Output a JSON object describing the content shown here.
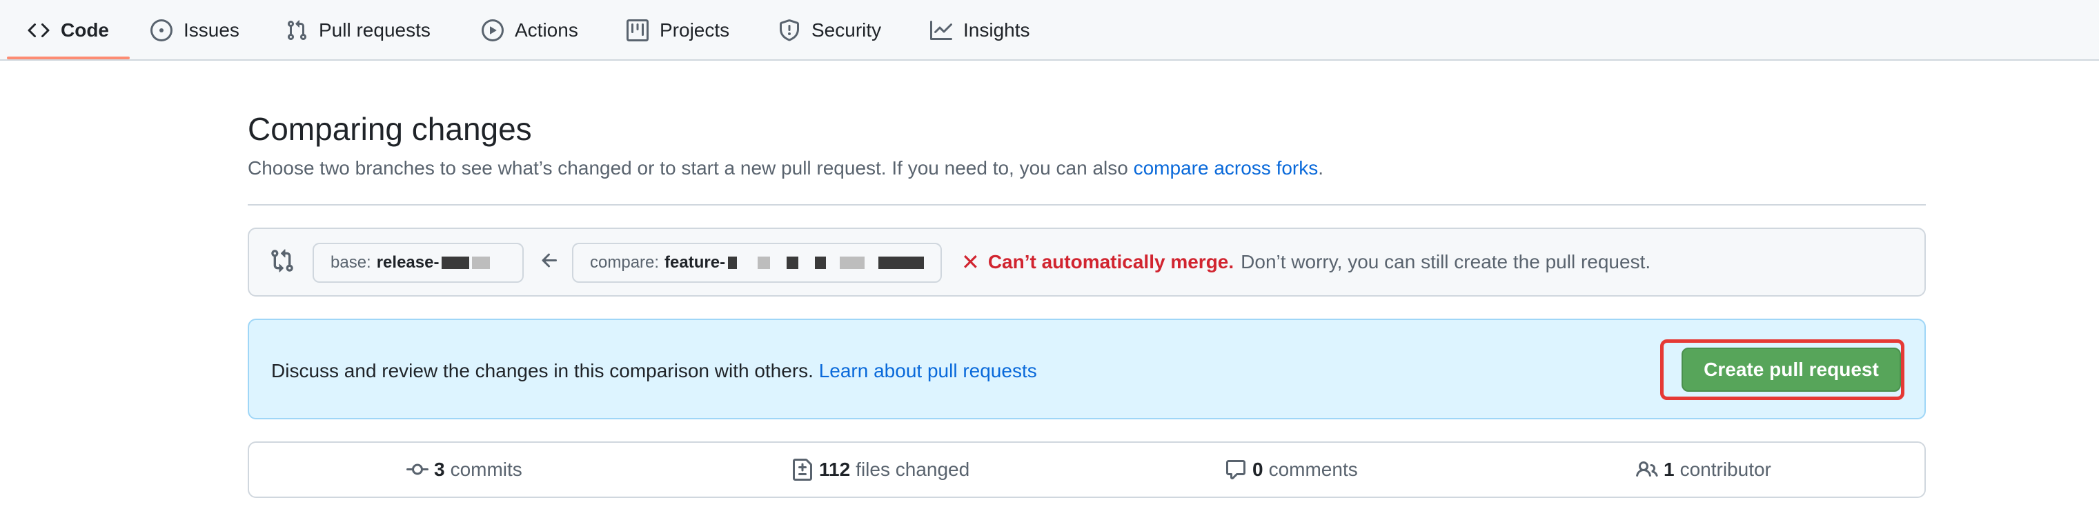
{
  "nav": {
    "tabs": [
      {
        "label": "Code",
        "icon": "code-icon",
        "selected": true
      },
      {
        "label": "Issues",
        "icon": "issue-icon",
        "selected": false
      },
      {
        "label": "Pull requests",
        "icon": "pull-request-icon",
        "selected": false
      },
      {
        "label": "Actions",
        "icon": "play-icon",
        "selected": false
      },
      {
        "label": "Projects",
        "icon": "table-icon",
        "selected": false
      },
      {
        "label": "Security",
        "icon": "shield-icon",
        "selected": false
      },
      {
        "label": "Insights",
        "icon": "graph-icon",
        "selected": false
      }
    ]
  },
  "page": {
    "title": "Comparing changes",
    "description": "Choose two branches to see what’s changed or to start a new pull request. If you need to, you can also ",
    "description_link": "compare across forks",
    "description_end": "."
  },
  "compare": {
    "base_prefix": "base:",
    "base_branch": "release-",
    "compare_prefix": "compare:",
    "compare_branch": "feature-",
    "merge_status": "Can’t automatically merge.",
    "merge_note": "Don’t worry, you can still create the pull request."
  },
  "discuss": {
    "text": "Discuss and review the changes in this comparison with others. ",
    "link": "Learn about pull requests",
    "button_label": "Create pull request"
  },
  "stats": {
    "commits_count": "3",
    "commits_label": "commits",
    "files_count": "112",
    "files_label": "files changed",
    "comments_count": "0",
    "comments_label": "comments",
    "contributors_count": "1",
    "contributors_label": "contributor"
  },
  "colors": {
    "accent_link": "#0969da",
    "tab_underline": "#fd8c73",
    "error": "#d1242f",
    "button_green": "#57a55a",
    "highlight": "#e53935"
  }
}
